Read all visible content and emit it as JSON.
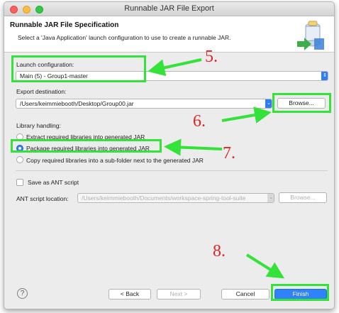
{
  "window": {
    "title": "Runnable JAR File Export"
  },
  "header": {
    "title": "Runnable JAR File Specification",
    "description": "Select a 'Java Application' launch configuration to use to create a runnable JAR."
  },
  "launch": {
    "label": "Launch configuration:",
    "value": "Main (5) - Group1-master"
  },
  "export": {
    "label": "Export destination:",
    "value": "/Users/keimmiebooth/Desktop/Group00.jar",
    "browse": "Browse..."
  },
  "library": {
    "label": "Library handling:",
    "options": [
      {
        "label": "Extract required libraries into generated JAR",
        "selected": false
      },
      {
        "label": "Package required libraries into generated JAR",
        "selected": true
      },
      {
        "label": "Copy required libraries into a sub-folder next to the generated JAR",
        "selected": false
      }
    ]
  },
  "ant": {
    "checkbox_label": "Save as ANT script",
    "location_label": "ANT script location:",
    "location_value": "/Users/keimmiebooth/Documents/workspace-spring-tool-suite",
    "browse": "Browse..."
  },
  "footer": {
    "help": "?",
    "back": "< Back",
    "next": "Next >",
    "cancel": "Cancel",
    "finish": "Finish"
  },
  "annotations": {
    "step5": "5.",
    "step6": "6.",
    "step7": "7.",
    "step8": "8."
  },
  "colors": {
    "highlight": "#34e23a",
    "annotation_text": "#e12424",
    "accent": "#2f7cf6"
  },
  "icons": [
    "help-icon",
    "wizard-jar-icon",
    "combo-arrow-icon"
  ]
}
